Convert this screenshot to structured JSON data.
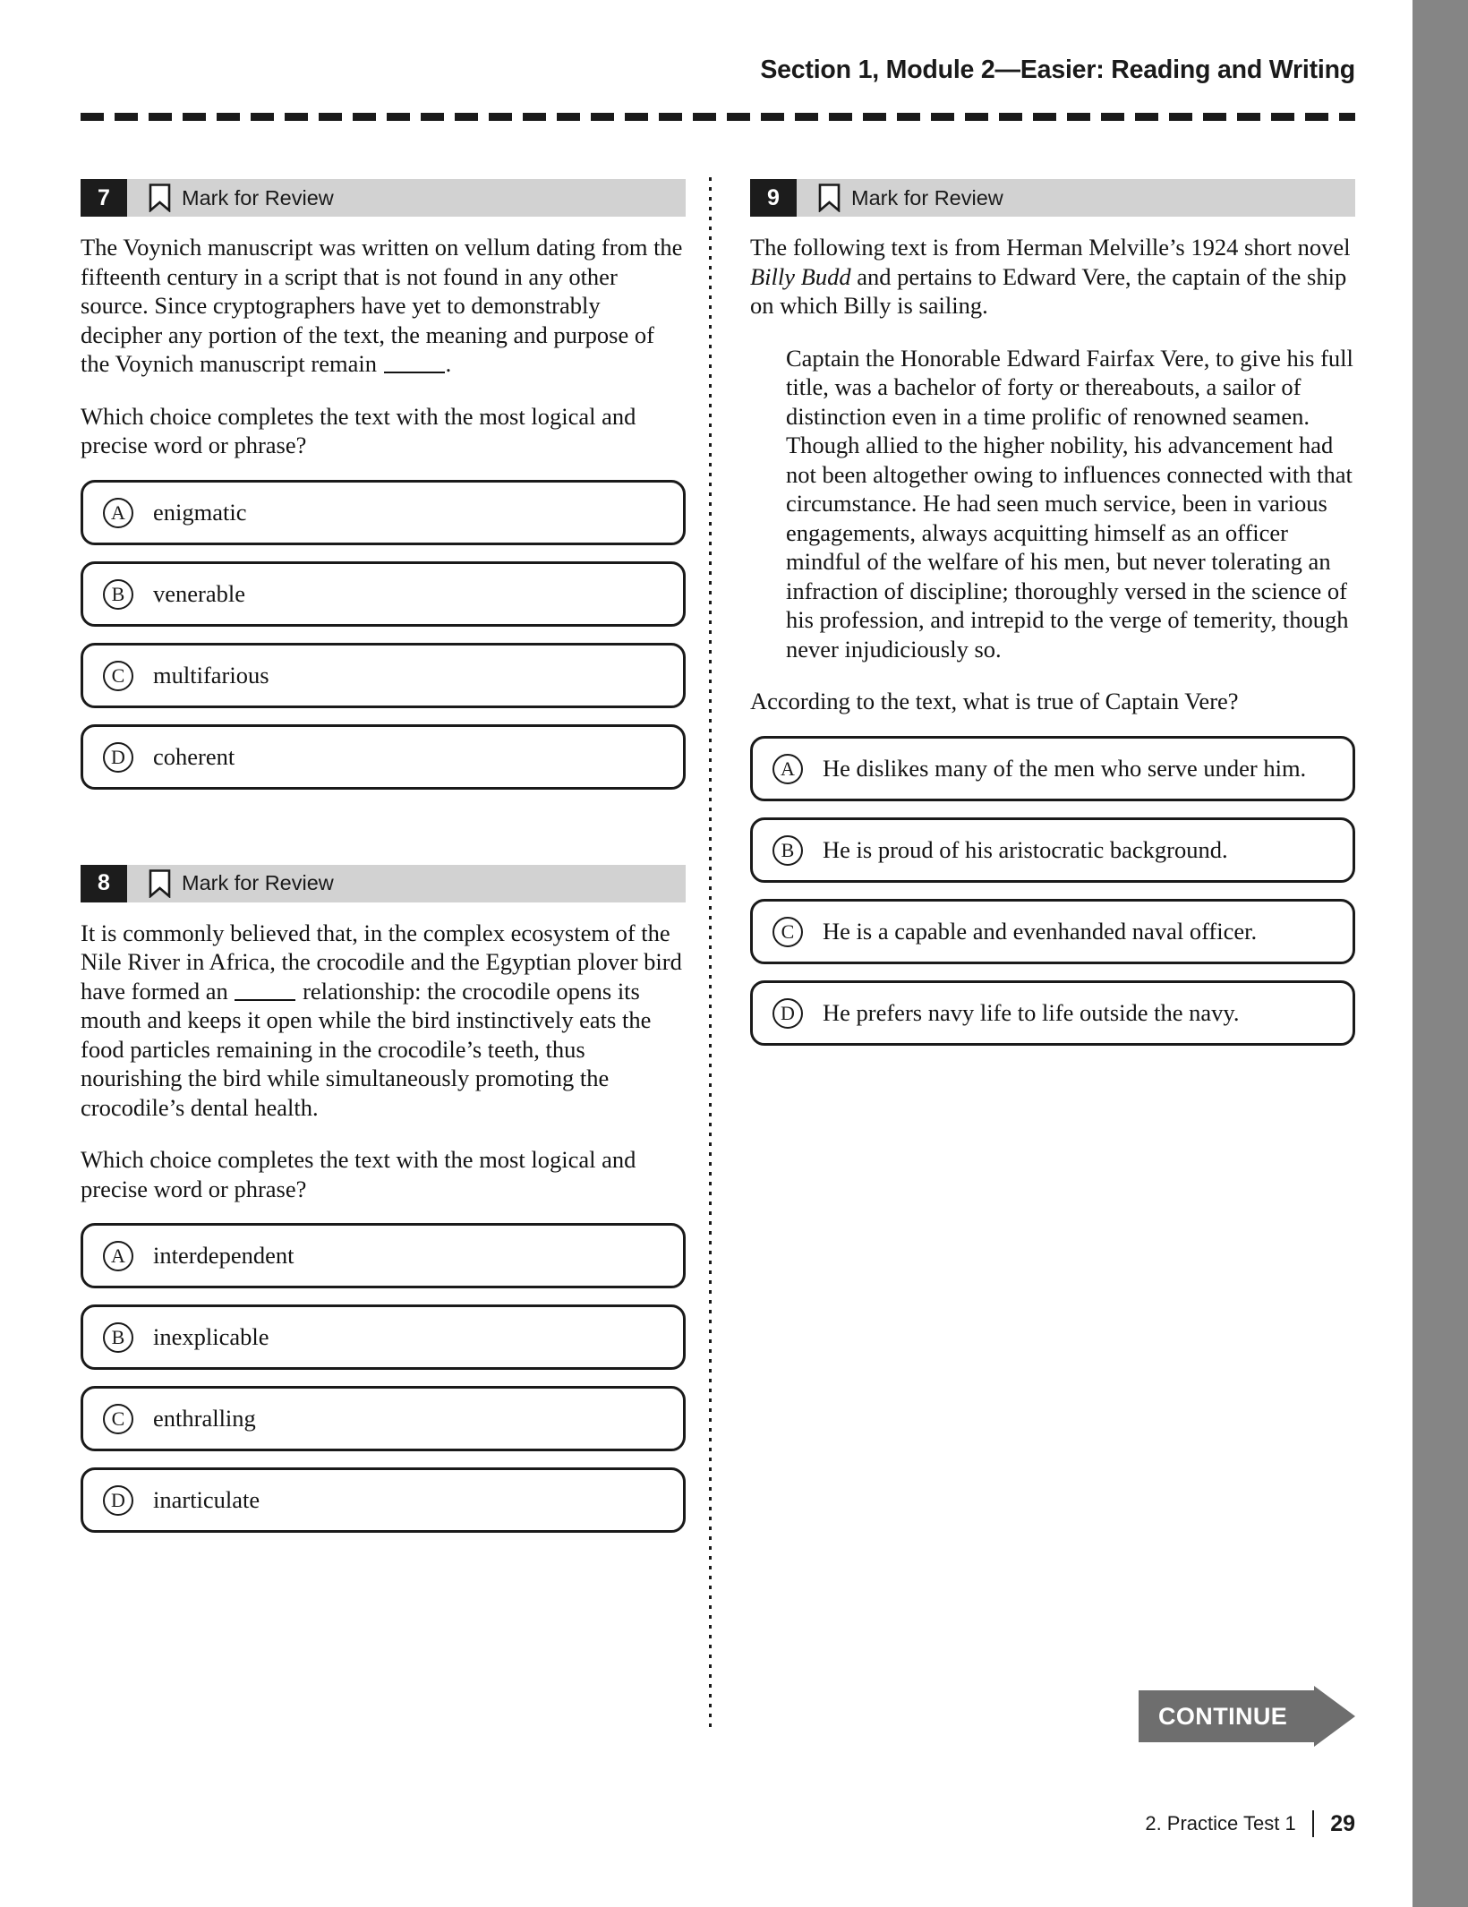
{
  "running_head": "Section 1, Module 2—Easier: Reading and Writing",
  "mark_for_review_label": "Mark for Review",
  "questions": [
    {
      "number": "7",
      "column": "left",
      "passage_pre": "The Voynich manuscript was written on vellum dating from the fifteenth century in a script that is not found in any other source. Since cryptographers have yet to demonstrably decipher any portion of the text, the meaning and purpose of the Voynich manuscript remain ",
      "passage_post": ".",
      "prompt": "Which choice completes the text with the most logical and precise word or phrase?",
      "choices": [
        {
          "letter": "A",
          "text": "enigmatic"
        },
        {
          "letter": "B",
          "text": "venerable"
        },
        {
          "letter": "C",
          "text": "multifarious"
        },
        {
          "letter": "D",
          "text": "coherent"
        }
      ]
    },
    {
      "number": "8",
      "column": "left",
      "passage_pre": "It is commonly believed that, in the complex ecosystem of the Nile River in Africa, the crocodile and the Egyptian plover bird have formed an ",
      "passage_post": " relationship: the crocodile opens its mouth and keeps it open while the bird instinctively eats the food particles remaining in the crocodile’s teeth, thus nourishing the bird while simultaneously promoting the crocodile’s dental health.",
      "prompt": "Which choice completes the text with the most logical and precise word or phrase?",
      "choices": [
        {
          "letter": "A",
          "text": "interdependent"
        },
        {
          "letter": "B",
          "text": "inexplicable"
        },
        {
          "letter": "C",
          "text": "enthralling"
        },
        {
          "letter": "D",
          "text": "inarticulate"
        }
      ]
    },
    {
      "number": "9",
      "column": "right",
      "intro_pre": "The following text is from Herman Melville’s 1924 short novel ",
      "intro_italic": "Billy Budd",
      "intro_post": " and pertains to Edward Vere, the captain of the ship on which Billy is sailing.",
      "blockquote": "Captain the Honorable Edward Fairfax Vere, to give his full title, was a bachelor of forty or thereabouts, a sailor of distinction even in a time prolific of renowned seamen. Though allied to the higher nobility, his advancement had not been altogether owing to influences connected with that circumstance. He had seen much service, been in various engagements, always acquitting himself as an officer mindful of the welfare of his men, but never tolerating an infraction of discipline; thoroughly versed in the science of his profession, and intrepid to the verge of temerity, though never injudiciously so.",
      "prompt": "According to the text, what is true of Captain Vere?",
      "choices": [
        {
          "letter": "A",
          "text": "He dislikes many of the men who serve under him."
        },
        {
          "letter": "B",
          "text": "He is proud of his aristocratic background."
        },
        {
          "letter": "C",
          "text": "He is a capable and evenhanded naval officer."
        },
        {
          "letter": "D",
          "text": "He prefers navy life to life outside the navy."
        }
      ]
    }
  ],
  "continue_button": {
    "label": "CONTINUE"
  },
  "footer": {
    "label": "2.  Practice Test 1",
    "page": "29"
  },
  "colors": {
    "edge_bar": "#858585",
    "question_strip": "#d2d2d2",
    "question_number_bg": "#1c1c1c",
    "continue_bg": "#6e6e6e",
    "text": "#141414"
  }
}
